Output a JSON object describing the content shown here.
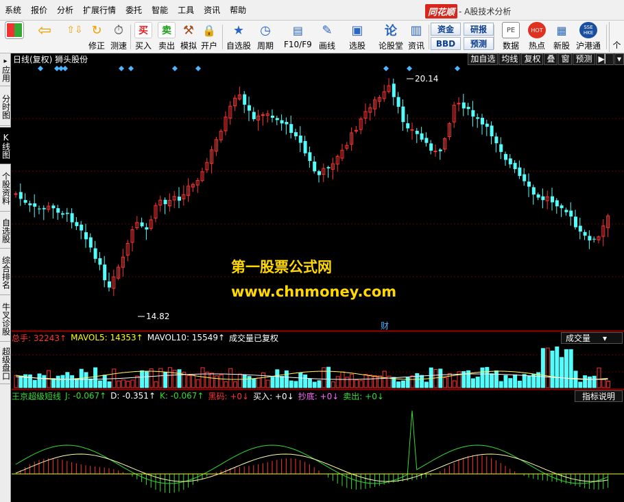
{
  "menu": [
    "系统",
    "报价",
    "分析",
    "扩展行情",
    "委托",
    "智能",
    "工具",
    "资讯",
    "帮助"
  ],
  "brand": {
    "logo": "同花顺",
    "subtitle": "- A股技术分析"
  },
  "toolbar": {
    "buttons": [
      {
        "label": "",
        "icon": "layout-grid-icon"
      },
      {
        "label": "",
        "icon": "back-arrow-icon"
      },
      {
        "label": "",
        "icon": "up-down-arrows-icon"
      },
      {
        "label": "修正",
        "icon": "fix-icon"
      },
      {
        "label": "测速",
        "icon": "clock-icon"
      },
      {
        "label": "买入",
        "icon": "buy-icon",
        "glyph": "买"
      },
      {
        "label": "卖出",
        "icon": "sell-icon",
        "glyph": "卖"
      },
      {
        "label": "模拟",
        "icon": "gavel-icon"
      },
      {
        "label": "开户",
        "icon": "lock-icon"
      },
      {
        "label": "自选股",
        "icon": "star-folder-icon"
      },
      {
        "label": "周期",
        "icon": "cycle-icon"
      },
      {
        "label": "F10/F9",
        "icon": "f10-icon"
      },
      {
        "label": "画线",
        "icon": "pen-icon"
      },
      {
        "label": "选股",
        "icon": "screen-icon"
      },
      {
        "label": "论股堂",
        "icon": "forum-icon",
        "glyph": "论"
      },
      {
        "label": "资讯",
        "icon": "news-icon"
      },
      {
        "label": "数据",
        "icon": "pe-icon",
        "glyph": "PE"
      },
      {
        "label": "热点",
        "icon": "hot-icon",
        "glyph": "HOT"
      },
      {
        "label": "新股",
        "icon": "ipo-icon"
      },
      {
        "label": "沪港通",
        "icon": "sse-hkex-icon",
        "glyph": "SSE HKE"
      }
    ],
    "small_buttons": [
      "资金",
      "BBD",
      "研报",
      "预测"
    ],
    "right_label": "个"
  },
  "left_tabs": [
    "应用",
    "分时图",
    "K线图",
    "个股资料",
    "自选股",
    "综合排名",
    "牛叉诊股",
    "超级盘口"
  ],
  "chart_header": {
    "title": "日线(复权) 狮头股份",
    "actions": [
      "加自选",
      "均线",
      "复权",
      "叠",
      "窗",
      "预测"
    ],
    "high_label": "20.14",
    "low_label": "14.82",
    "cai_label": "财"
  },
  "volume": {
    "total": "总手: 32243↑",
    "ma5": "MAVOL5: 14353↑",
    "ma10": "MAVOL10: 15549↑",
    "note": "成交量已复权",
    "selector": "成交量"
  },
  "indicator": {
    "name": "王京超级短线",
    "j": "J: -0.067↑",
    "d": "D: -0.351↑",
    "k": "K: -0.067↑",
    "heima": "黑码: +0↓",
    "buy": "买入: +0↓",
    "chaodi": "抄底: +0↓",
    "sell": "卖出: +0↓",
    "help": "指标说明"
  },
  "watermark": {
    "line1": "第一股票公式网",
    "line2": "www.chnmoney.com"
  },
  "colors": {
    "up": "#ff3232",
    "down": "#54fcfc",
    "bg": "#000000",
    "grid": "#7a0000",
    "accent": "#ffd800"
  }
}
